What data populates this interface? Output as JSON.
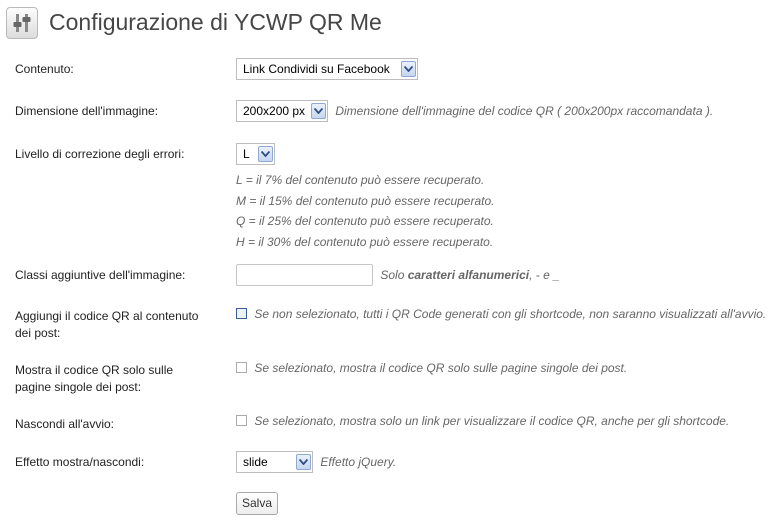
{
  "header": {
    "title": "Configurazione di YCWP QR Me",
    "icon": "settings-sliders-icon"
  },
  "form": {
    "content": {
      "label": "Contenuto:",
      "value": "Link Condividi su Facebook"
    },
    "image_size": {
      "label": "Dimensione dell'immagine:",
      "value": "200x200 px",
      "description": "Dimensione dell'immagine del codice QR ( 200x200px raccomandata )."
    },
    "error_correction": {
      "label": "Livello di correzione degli errori:",
      "value": "L",
      "notes": [
        "L = il 7% del contenuto può essere recuperato.",
        "M = il 15% del contenuto può essere recuperato.",
        "Q = il 25% del contenuto può essere recuperato.",
        "H = il 30% del contenuto può essere recuperato."
      ]
    },
    "image_classes": {
      "label": "Classi aggiuntive dell'immagine:",
      "value": "",
      "desc_prefix": "Solo ",
      "desc_bold": "caratteri alfanumerici",
      "desc_suffix": ", - e _"
    },
    "add_to_content": {
      "label": "Aggiungi il codice QR al contenuto dei post:",
      "checked": false,
      "description": "Se non selezionato, tutti i QR Code generati con gli shortcode, non saranno visualizzati all'avvio."
    },
    "single_only": {
      "label": "Mostra il codice QR solo sulle pagine singole dei post:",
      "checked": false,
      "description": "Se selezionato, mostra il codice QR solo sulle pagine singole dei post."
    },
    "hide_on_start": {
      "label": "Nascondi all'avvio:",
      "checked": false,
      "description": "Se selezionato, mostra solo un link per visualizzare il codice QR, anche per gli shortcode."
    },
    "effect": {
      "label": "Effetto mostra/nascondi:",
      "value": "slide",
      "description": "Effetto jQuery."
    },
    "save_label": "Salva"
  }
}
